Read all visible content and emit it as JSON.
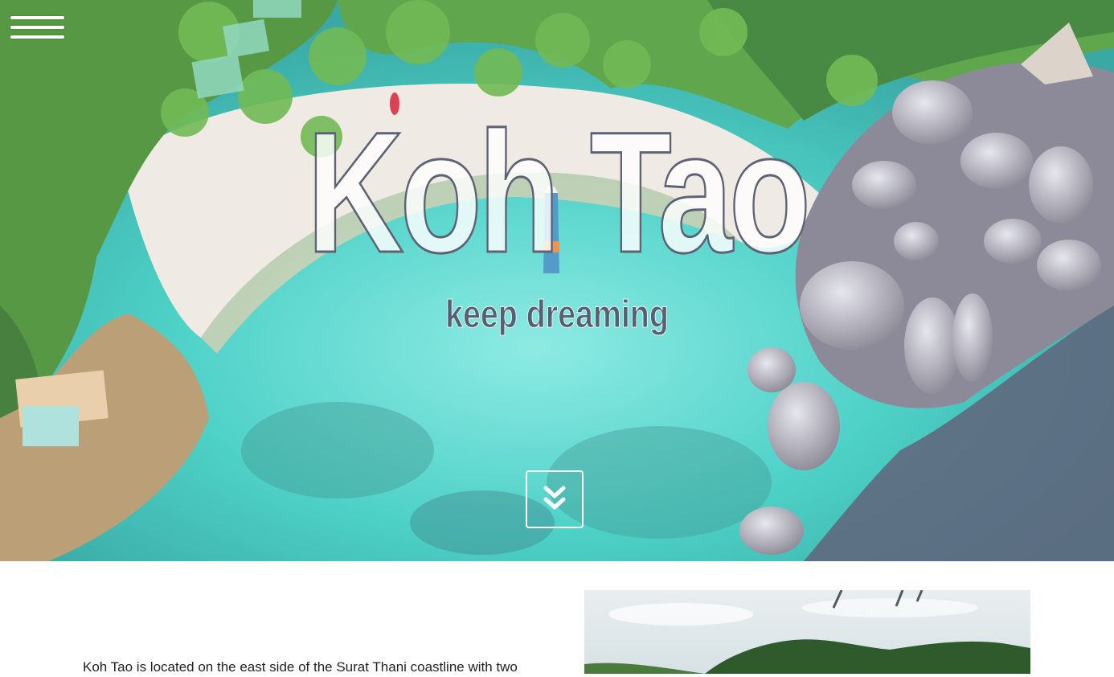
{
  "hero": {
    "title": "Koh Tao",
    "subtitle": "keep dreaming",
    "menu_icon": "hamburger-menu-icon",
    "scroll_icon": "double-chevron-down-icon"
  },
  "content": {
    "intro": "Koh Tao is located on the east side of the Surat Thani coastline with two"
  },
  "colors": {
    "water": "#3fd2c7",
    "sand": "#eae3dc",
    "foliage": "#3f8a2a",
    "rock": "#9e9ba8",
    "title_stroke": "#5d6274"
  }
}
